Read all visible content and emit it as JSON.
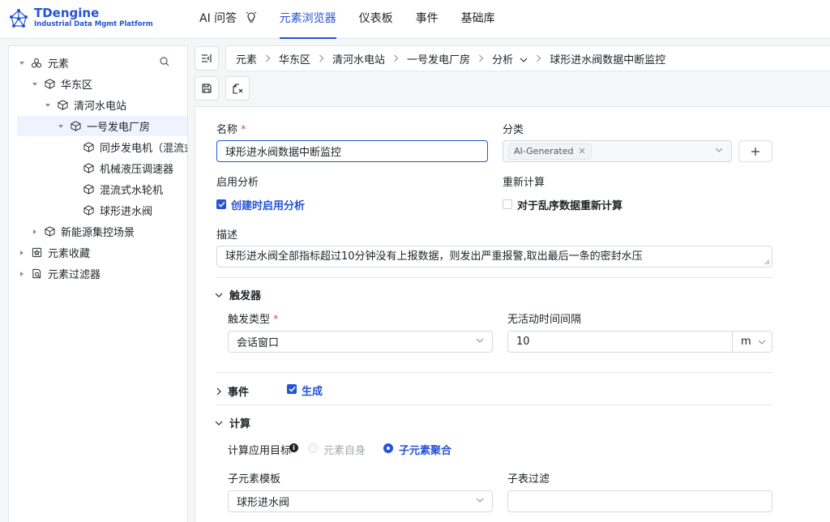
{
  "app": {
    "logo_title": "TDengine",
    "logo_subtitle": "Industrial Data Mgmt Platform",
    "accent_color": "#2453d6"
  },
  "nav": {
    "items": [
      {
        "label": "AI 问答",
        "icon": "lightbulb-icon"
      },
      {
        "label": "元素浏览器"
      },
      {
        "label": "仪表板"
      },
      {
        "label": "事件"
      },
      {
        "label": "基础库"
      }
    ],
    "active": "元素浏览器"
  },
  "sidebar": {
    "root_label": "元素",
    "tree": [
      {
        "label": "华东区",
        "icon": "cube-icon"
      },
      {
        "label": "清河水电站",
        "icon": "cube-icon"
      },
      {
        "label": "一号发电厂房",
        "icon": "cube-icon",
        "selected": true
      },
      {
        "label": "同步发电机（混流式",
        "icon": "cube-icon"
      },
      {
        "label": "机械液压调速器",
        "icon": "cube-icon"
      },
      {
        "label": "混流式水轮机",
        "icon": "cube-icon"
      },
      {
        "label": "球形进水阀",
        "icon": "cube-icon"
      },
      {
        "label": "新能源集控场景",
        "icon": "cube-icon"
      },
      {
        "label": "元素收藏",
        "icon": "favorites-icon"
      },
      {
        "label": "元素过滤器",
        "icon": "filter-doc-icon"
      }
    ]
  },
  "breadcrumb": [
    "元素",
    "华东区",
    "清河水电站",
    "一号发电厂房",
    "分析",
    "球形进水阀数据中断监控"
  ],
  "form": {
    "name_label": "名称",
    "name_value": "球形进水阀数据中断监控",
    "category_label": "分类",
    "category_tag": "AI-Generated",
    "enable_section_label": "启用分析",
    "enable_checkbox_label": "创建时启用分析",
    "enable_checked": true,
    "recalc_label": "重新计算",
    "recalc_checkbox_label": "对于乱序数据重新计算",
    "recalc_checked": false,
    "description_label": "描述",
    "description_value": "球形进水阀全部指标超过10分钟没有上报数据，则发出严重报警,取出最后一条的密封水压",
    "trigger_section": "触发器",
    "trigger_type_label": "触发类型",
    "trigger_type_value": "会话窗口",
    "idle_interval_label": "无活动时间间隔",
    "idle_interval_value": "10",
    "idle_interval_unit": "m",
    "event_section": "事件",
    "event_generate_label": "生成",
    "event_generate_checked": true,
    "calc_section": "计算",
    "calc_target_label": "计算应用目标",
    "calc_target_options": [
      "元素自身",
      "子元素聚合"
    ],
    "calc_target_selected": "子元素聚合",
    "child_template_label": "子元素模板",
    "child_template_value": "球形进水阀",
    "child_filter_label": "子表过滤",
    "child_filter_value": ""
  }
}
